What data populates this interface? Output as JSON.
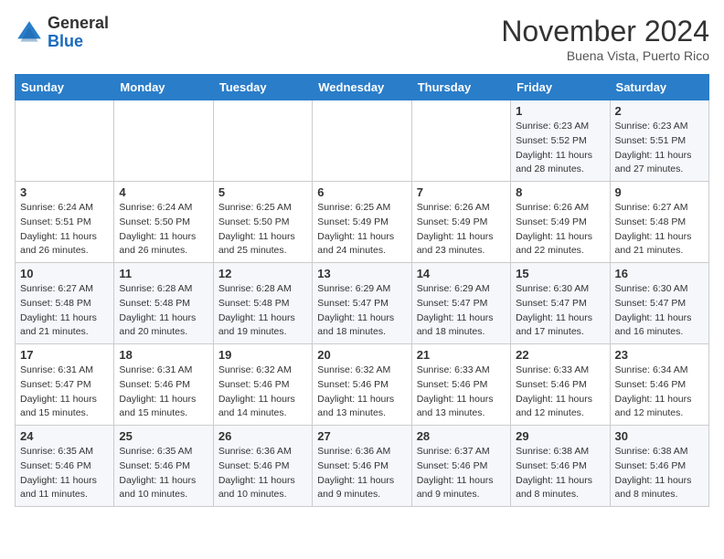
{
  "header": {
    "logo_general": "General",
    "logo_blue": "Blue",
    "month_title": "November 2024",
    "subtitle": "Buena Vista, Puerto Rico"
  },
  "days_of_week": [
    "Sunday",
    "Monday",
    "Tuesday",
    "Wednesday",
    "Thursday",
    "Friday",
    "Saturday"
  ],
  "weeks": [
    [
      {
        "day": "",
        "info": ""
      },
      {
        "day": "",
        "info": ""
      },
      {
        "day": "",
        "info": ""
      },
      {
        "day": "",
        "info": ""
      },
      {
        "day": "",
        "info": ""
      },
      {
        "day": "1",
        "info": "Sunrise: 6:23 AM\nSunset: 5:52 PM\nDaylight: 11 hours and 28 minutes."
      },
      {
        "day": "2",
        "info": "Sunrise: 6:23 AM\nSunset: 5:51 PM\nDaylight: 11 hours and 27 minutes."
      }
    ],
    [
      {
        "day": "3",
        "info": "Sunrise: 6:24 AM\nSunset: 5:51 PM\nDaylight: 11 hours and 26 minutes."
      },
      {
        "day": "4",
        "info": "Sunrise: 6:24 AM\nSunset: 5:50 PM\nDaylight: 11 hours and 26 minutes."
      },
      {
        "day": "5",
        "info": "Sunrise: 6:25 AM\nSunset: 5:50 PM\nDaylight: 11 hours and 25 minutes."
      },
      {
        "day": "6",
        "info": "Sunrise: 6:25 AM\nSunset: 5:49 PM\nDaylight: 11 hours and 24 minutes."
      },
      {
        "day": "7",
        "info": "Sunrise: 6:26 AM\nSunset: 5:49 PM\nDaylight: 11 hours and 23 minutes."
      },
      {
        "day": "8",
        "info": "Sunrise: 6:26 AM\nSunset: 5:49 PM\nDaylight: 11 hours and 22 minutes."
      },
      {
        "day": "9",
        "info": "Sunrise: 6:27 AM\nSunset: 5:48 PM\nDaylight: 11 hours and 21 minutes."
      }
    ],
    [
      {
        "day": "10",
        "info": "Sunrise: 6:27 AM\nSunset: 5:48 PM\nDaylight: 11 hours and 21 minutes."
      },
      {
        "day": "11",
        "info": "Sunrise: 6:28 AM\nSunset: 5:48 PM\nDaylight: 11 hours and 20 minutes."
      },
      {
        "day": "12",
        "info": "Sunrise: 6:28 AM\nSunset: 5:48 PM\nDaylight: 11 hours and 19 minutes."
      },
      {
        "day": "13",
        "info": "Sunrise: 6:29 AM\nSunset: 5:47 PM\nDaylight: 11 hours and 18 minutes."
      },
      {
        "day": "14",
        "info": "Sunrise: 6:29 AM\nSunset: 5:47 PM\nDaylight: 11 hours and 18 minutes."
      },
      {
        "day": "15",
        "info": "Sunrise: 6:30 AM\nSunset: 5:47 PM\nDaylight: 11 hours and 17 minutes."
      },
      {
        "day": "16",
        "info": "Sunrise: 6:30 AM\nSunset: 5:47 PM\nDaylight: 11 hours and 16 minutes."
      }
    ],
    [
      {
        "day": "17",
        "info": "Sunrise: 6:31 AM\nSunset: 5:47 PM\nDaylight: 11 hours and 15 minutes."
      },
      {
        "day": "18",
        "info": "Sunrise: 6:31 AM\nSunset: 5:46 PM\nDaylight: 11 hours and 15 minutes."
      },
      {
        "day": "19",
        "info": "Sunrise: 6:32 AM\nSunset: 5:46 PM\nDaylight: 11 hours and 14 minutes."
      },
      {
        "day": "20",
        "info": "Sunrise: 6:32 AM\nSunset: 5:46 PM\nDaylight: 11 hours and 13 minutes."
      },
      {
        "day": "21",
        "info": "Sunrise: 6:33 AM\nSunset: 5:46 PM\nDaylight: 11 hours and 13 minutes."
      },
      {
        "day": "22",
        "info": "Sunrise: 6:33 AM\nSunset: 5:46 PM\nDaylight: 11 hours and 12 minutes."
      },
      {
        "day": "23",
        "info": "Sunrise: 6:34 AM\nSunset: 5:46 PM\nDaylight: 11 hours and 12 minutes."
      }
    ],
    [
      {
        "day": "24",
        "info": "Sunrise: 6:35 AM\nSunset: 5:46 PM\nDaylight: 11 hours and 11 minutes."
      },
      {
        "day": "25",
        "info": "Sunrise: 6:35 AM\nSunset: 5:46 PM\nDaylight: 11 hours and 10 minutes."
      },
      {
        "day": "26",
        "info": "Sunrise: 6:36 AM\nSunset: 5:46 PM\nDaylight: 11 hours and 10 minutes."
      },
      {
        "day": "27",
        "info": "Sunrise: 6:36 AM\nSunset: 5:46 PM\nDaylight: 11 hours and 9 minutes."
      },
      {
        "day": "28",
        "info": "Sunrise: 6:37 AM\nSunset: 5:46 PM\nDaylight: 11 hours and 9 minutes."
      },
      {
        "day": "29",
        "info": "Sunrise: 6:38 AM\nSunset: 5:46 PM\nDaylight: 11 hours and 8 minutes."
      },
      {
        "day": "30",
        "info": "Sunrise: 6:38 AM\nSunset: 5:46 PM\nDaylight: 11 hours and 8 minutes."
      }
    ]
  ]
}
